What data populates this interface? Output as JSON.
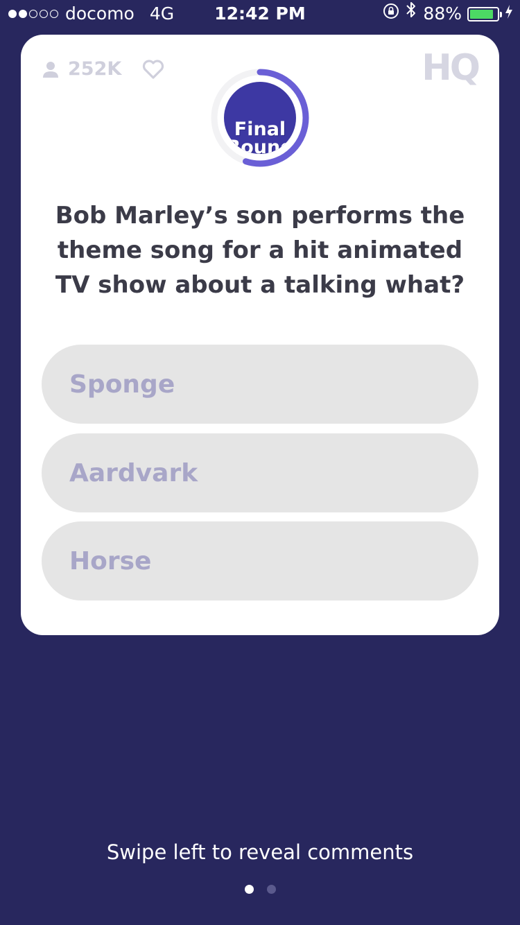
{
  "status_bar": {
    "carrier": "docomo",
    "network": "4G",
    "time": "12:42 PM",
    "battery": "88%",
    "battery_level": 0.88,
    "signal_bars_filled": 2,
    "signal_bars_total": 5,
    "icons": [
      "orientation-lock-icon",
      "bluetooth-icon",
      "battery-icon",
      "charging-bolt-icon"
    ]
  },
  "header": {
    "viewer_count": "252K",
    "logo": "HQ"
  },
  "timer": {
    "label": "Final Round",
    "progress": 0.55,
    "colors": {
      "arc": "#6a5fd6",
      "track": "#f2f2f4",
      "inner": "#3d38a3"
    }
  },
  "question": {
    "text": "Bob Marley’s son performs the theme song for a hit animated TV show about a talking what?"
  },
  "answers": [
    {
      "label": "Sponge"
    },
    {
      "label": "Aardvark"
    },
    {
      "label": "Horse"
    }
  ],
  "footer": {
    "hint": "Swipe left to reveal comments",
    "pages": 2,
    "active_page": 1
  },
  "colors": {
    "background": "#28275e",
    "card": "#ffffff",
    "answer_bg": "#e5e5e5",
    "answer_text": "#a8a6c8"
  }
}
